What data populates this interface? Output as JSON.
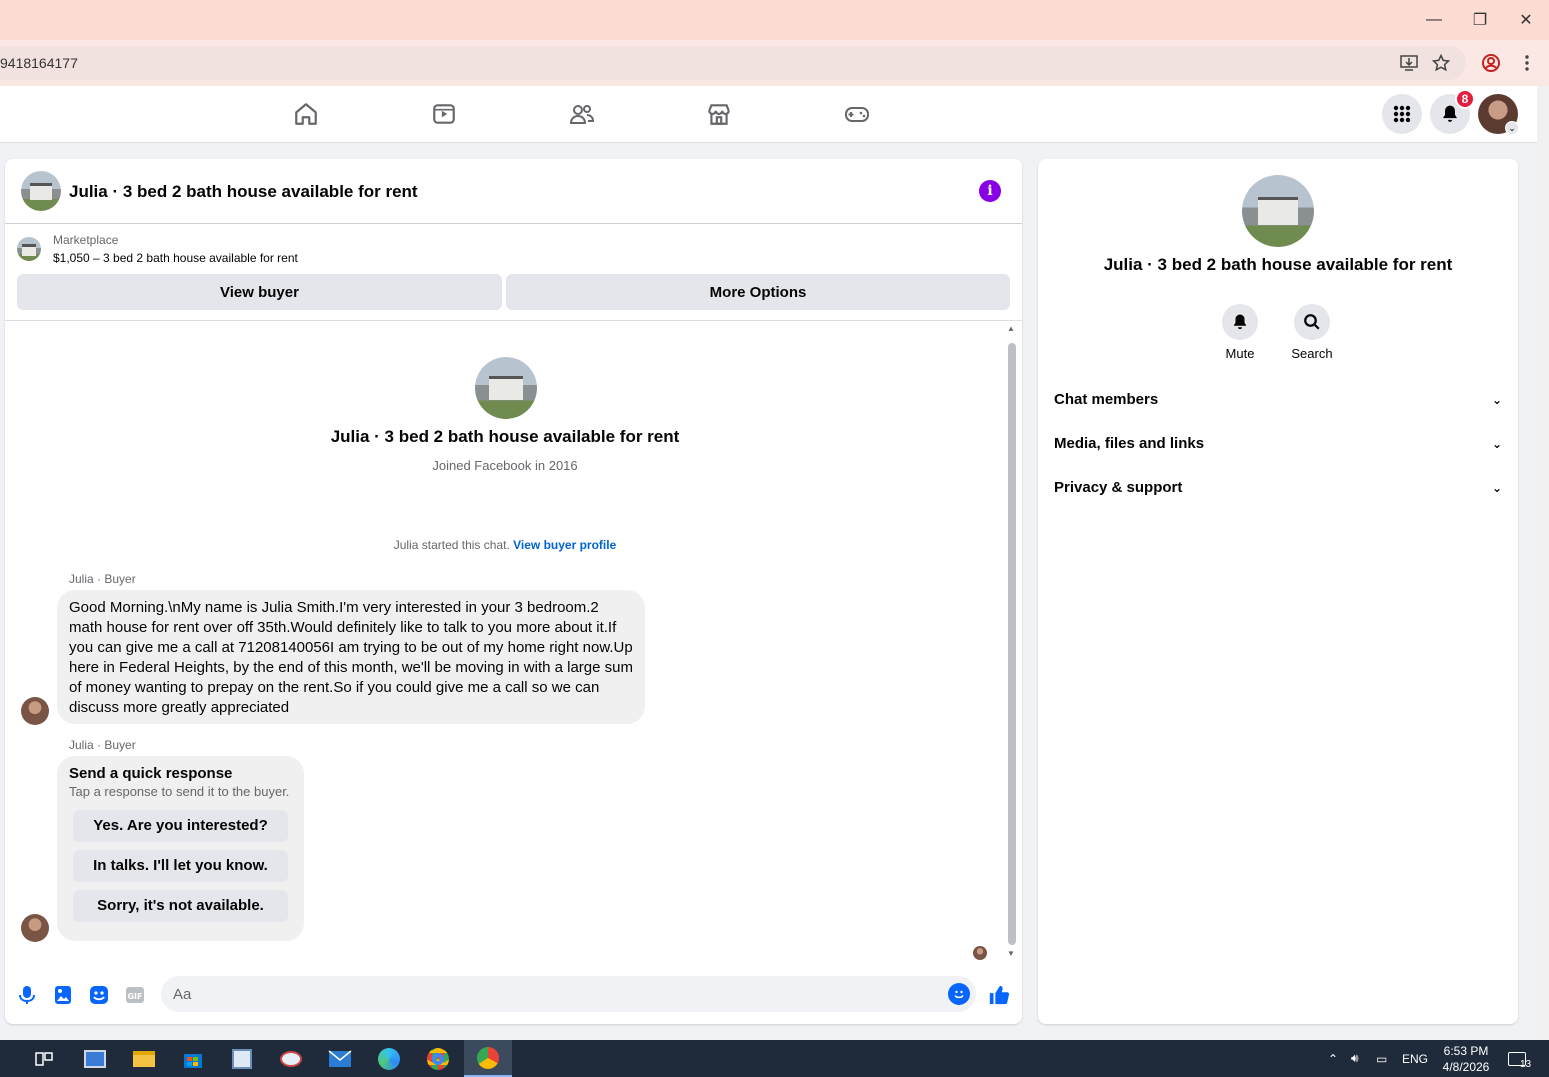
{
  "browser": {
    "url": "9418164177",
    "window_controls": {
      "minimize": "—",
      "restore": "❐",
      "close": "✕"
    }
  },
  "fb_nav": {
    "icons": [
      "home-icon",
      "video-icon",
      "friends-icon",
      "marketplace-icon",
      "gaming-icon"
    ],
    "notification_count": "8"
  },
  "chat": {
    "title": "Julia · 3 bed 2 bath house available for rent",
    "marketplace_label": "Marketplace",
    "listing_summary": "$1,050 – 3 bed 2 bath house available for rent",
    "view_buyer": "View buyer",
    "more_options": "More Options",
    "profile_name": "Julia · 3 bed 2 bath house available for rent",
    "joined": "Joined Facebook in 2016",
    "started_text": "Julia started this chat.",
    "view_buyer_profile": "View buyer profile",
    "messages": [
      {
        "sender": "Julia · Buyer",
        "text": "Good Morning.\\nMy name is Julia Smith.I'm very interested in your 3 bedroom.2 math house for rent over off 35th.Would definitely like to talk to you more about it.If you can give me a call at 71208140056I am trying to be out of my home right now.Up here in Federal Heights, by the end of this month, we'll be moving in with a large sum of money wanting to prepay on the rent.So if you could give me a call so we can discuss more greatly appreciated"
      },
      {
        "sender": "Julia · Buyer",
        "quick_response_title": "Send a quick response",
        "quick_response_sub": "Tap a response to send it to the buyer.",
        "options": [
          "Yes. Are you interested?",
          "In talks. I'll let you know.",
          "Sorry, it's not available."
        ]
      }
    ],
    "composer_placeholder": "Aa"
  },
  "info_panel": {
    "name": "Julia · 3 bed 2 bath house available for rent",
    "mute": "Mute",
    "search": "Search",
    "sections": [
      "Chat members",
      "Media, files and links",
      "Privacy & support"
    ]
  },
  "taskbar": {
    "language": "ENG",
    "time": "6:53 PM",
    "date": "4/8/2026",
    "notifications": "13"
  },
  "colors": {
    "accent_blue": "#0866ff",
    "info_purple": "#8a00e6",
    "badge_red": "#e41e3f"
  }
}
